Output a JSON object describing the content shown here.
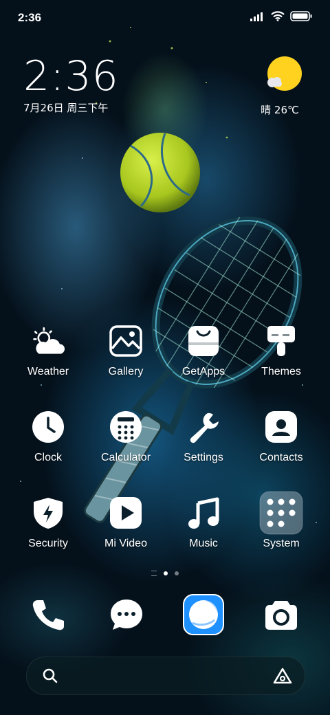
{
  "status_bar": {
    "time": "2:36"
  },
  "clock_widget": {
    "time": "2:36",
    "date": "7月26日 周三下午"
  },
  "weather_widget": {
    "text": "晴 26℃",
    "icon": "sun-cloud-icon"
  },
  "apps": [
    {
      "label": "Weather",
      "icon": "weather-icon"
    },
    {
      "label": "Gallery",
      "icon": "gallery-icon"
    },
    {
      "label": "GetApps",
      "icon": "shopping-bag-icon"
    },
    {
      "label": "Themes",
      "icon": "brush-icon"
    },
    {
      "label": "Clock",
      "icon": "clock-icon"
    },
    {
      "label": "Calculator",
      "icon": "calculator-icon"
    },
    {
      "label": "Settings",
      "icon": "wrench-icon"
    },
    {
      "label": "Contacts",
      "icon": "contact-icon"
    },
    {
      "label": "Security",
      "icon": "shield-bolt-icon"
    },
    {
      "label": "Mi Video",
      "icon": "play-icon"
    },
    {
      "label": "Music",
      "icon": "music-note-icon"
    },
    {
      "label": "System",
      "icon": "folder-icon"
    }
  ],
  "page_indicator": {
    "pages": 2,
    "current": 1
  },
  "dock": [
    {
      "name": "phone",
      "icon": "phone-icon"
    },
    {
      "name": "messages",
      "icon": "chat-icon"
    },
    {
      "name": "browser",
      "icon": "browser-icon"
    },
    {
      "name": "camera",
      "icon": "camera-icon"
    }
  ],
  "search_bar": {
    "left_icon": "search-icon",
    "right_icon": "assistant-icon"
  },
  "colors": {
    "weather_sun": "#FFD21F",
    "browser_accent": "#1E90FF",
    "tennis_ball": "#B5D62A"
  }
}
